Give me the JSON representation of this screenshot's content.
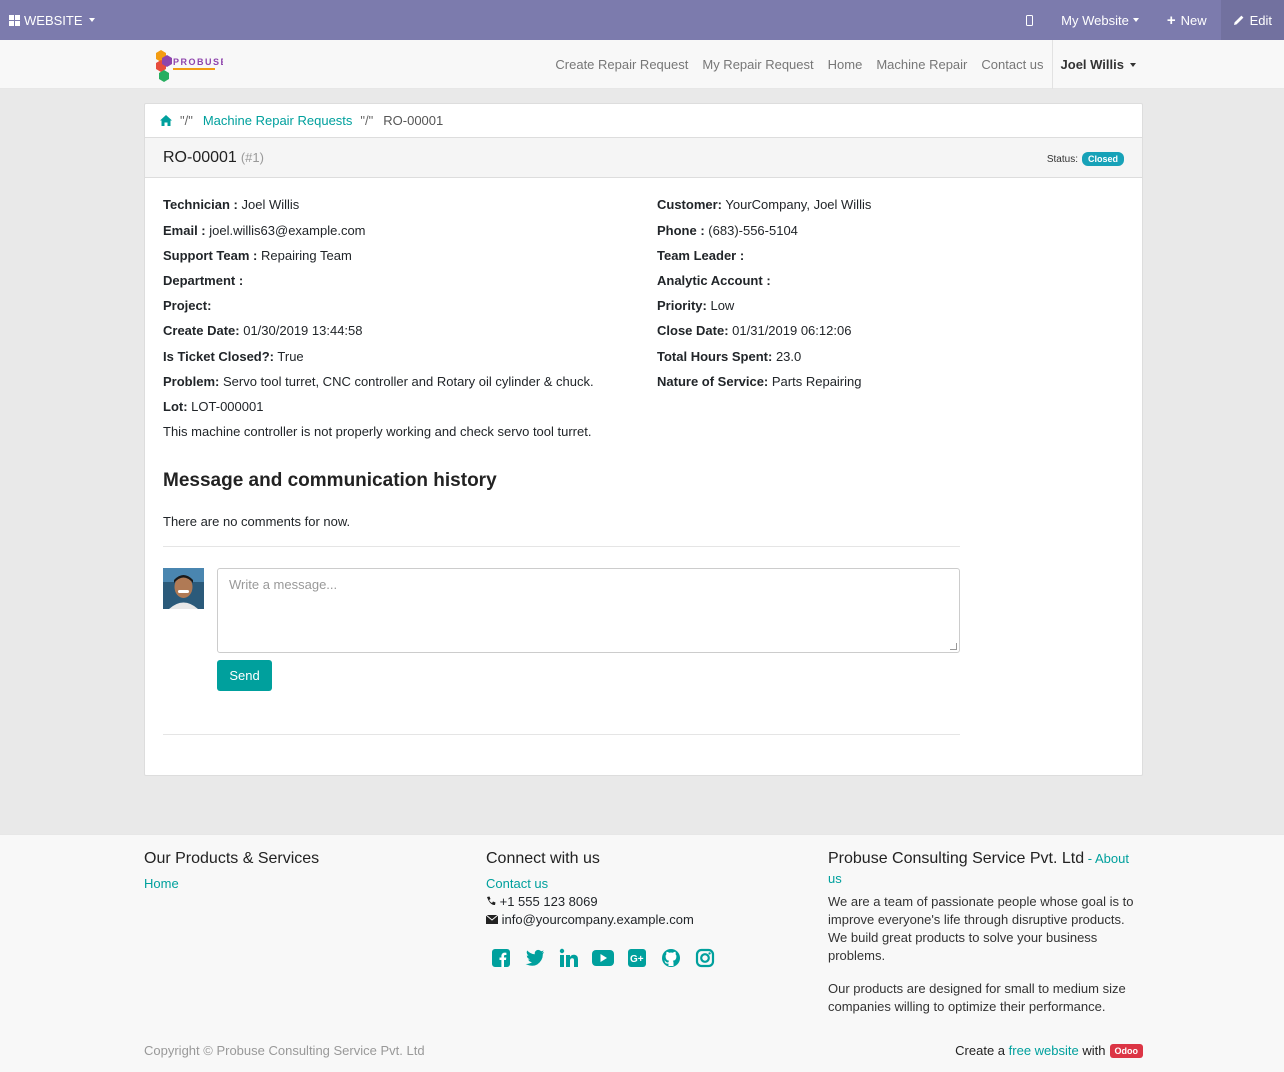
{
  "adminbar": {
    "website_label": "WEBSITE",
    "mywebsite_label": "My Website",
    "new_label": "New",
    "edit_label": "Edit"
  },
  "header": {
    "logo_text": "PROBUSE",
    "nav": [
      "Create Repair Request",
      "My Repair Request",
      "Home",
      "Machine Repair",
      "Contact us"
    ],
    "user": "Joel Willis"
  },
  "breadcrumb": {
    "sep1": "\"/\"",
    "link": "Machine Repair Requests",
    "sep2": "\"/\"",
    "current": "RO-00001"
  },
  "ticket": {
    "ref": "RO-00001",
    "num": "(#1)",
    "status_label": "Status:",
    "status": "Closed",
    "left": [
      {
        "label": "Technician :",
        "value": "Joel Willis"
      },
      {
        "label": "Email :",
        "value": "joel.willis63@example.com"
      },
      {
        "label": "Support Team :",
        "value": "Repairing Team"
      },
      {
        "label": "Department :",
        "value": ""
      },
      {
        "label": "Project:",
        "value": ""
      },
      {
        "label": "Create Date:",
        "value": "01/30/2019 13:44:58"
      },
      {
        "label": "Is Ticket Closed?:",
        "value": "True"
      },
      {
        "label": "Problem:",
        "value": "Servo tool turret, CNC controller and Rotary oil cylinder & chuck."
      },
      {
        "label": "Lot:",
        "value": "LOT-000001"
      }
    ],
    "right": [
      {
        "label": "Customer:",
        "value": "YourCompany, Joel Willis"
      },
      {
        "label": "Phone :",
        "value": "(683)-556-5104"
      },
      {
        "label": "Team Leader :",
        "value": ""
      },
      {
        "label": "Analytic Account :",
        "value": ""
      },
      {
        "label": "Priority:",
        "value": "Low"
      },
      {
        "label": "Close Date:",
        "value": "01/31/2019 06:12:06"
      },
      {
        "label": "Total Hours Spent:",
        "value": "23.0"
      },
      {
        "label": "Nature of Service:",
        "value": "Parts Repairing"
      }
    ],
    "description": "This machine controller is not properly working and check servo tool turret."
  },
  "messages": {
    "heading": "Message and communication history",
    "empty": "There are no comments for now.",
    "placeholder": "Write a message...",
    "send": "Send"
  },
  "footer": {
    "col1_title": "Our Products & Services",
    "col1_link": "Home",
    "col2_title": "Connect with us",
    "col2_link": "Contact us",
    "phone": "+1 555 123 8069",
    "email": "info@yourcompany.example.com",
    "col3_title": "Probuse Consulting Service Pvt. Ltd",
    "col3_dash": " - ",
    "col3_link": "About us",
    "about_p1": "We are a team of passionate people whose goal is to improve everyone's life through disruptive products. We build great products to solve your business problems.",
    "about_p2": "Our products are designed for small to medium size companies willing to optimize their performance.",
    "copyright": "Copyright © Probuse Consulting Service Pvt. Ltd",
    "powered_pre": "Create a",
    "powered_link": "free website",
    "powered_mid": "with",
    "powered_badge": "Odoo"
  },
  "colors": {
    "adminbar": "#7c7bad",
    "accent": "#00a09d",
    "status_badge": "#17a2b8",
    "odoo_badge": "#dc3545"
  }
}
